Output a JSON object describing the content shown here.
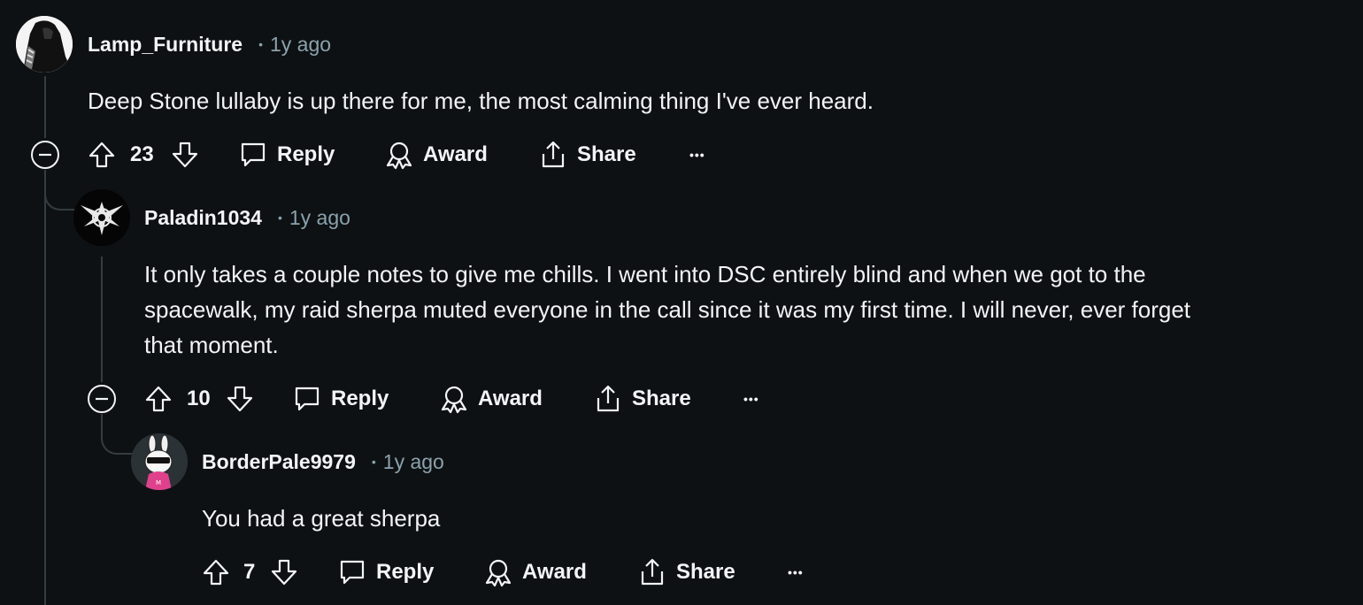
{
  "comments": [
    {
      "username": "Lamp_Furniture",
      "separator": "•",
      "age": "1y ago",
      "lines": [
        "Deep Stone lullaby is up there for me, the most calming thing I've ever heard."
      ],
      "votes": "23",
      "reply_label": "Reply",
      "award_label": "Award",
      "share_label": "Share",
      "more_label": "•••"
    },
    {
      "username": "Paladin1034",
      "separator": "•",
      "age": "1y ago",
      "lines": [
        "It only takes a couple notes to give me chills. I went into DSC entirely blind and when we got to the",
        "spacewalk, my raid sherpa muted everyone in the call since it was my first time. I will never, ever forget",
        "that moment."
      ],
      "votes": "10",
      "reply_label": "Reply",
      "award_label": "Award",
      "share_label": "Share",
      "more_label": "•••"
    },
    {
      "username": "BorderPale9979",
      "separator": "•",
      "age": "1y ago",
      "lines": [
        "You had a great sherpa"
      ],
      "votes": "7",
      "reply_label": "Reply",
      "award_label": "Award",
      "share_label": "Share",
      "more_label": "•••"
    }
  ],
  "colors": {
    "background": "#0e1113",
    "text": "#f2f4f5",
    "muted": "#8ba2ad",
    "thread_line": "#333d42"
  }
}
